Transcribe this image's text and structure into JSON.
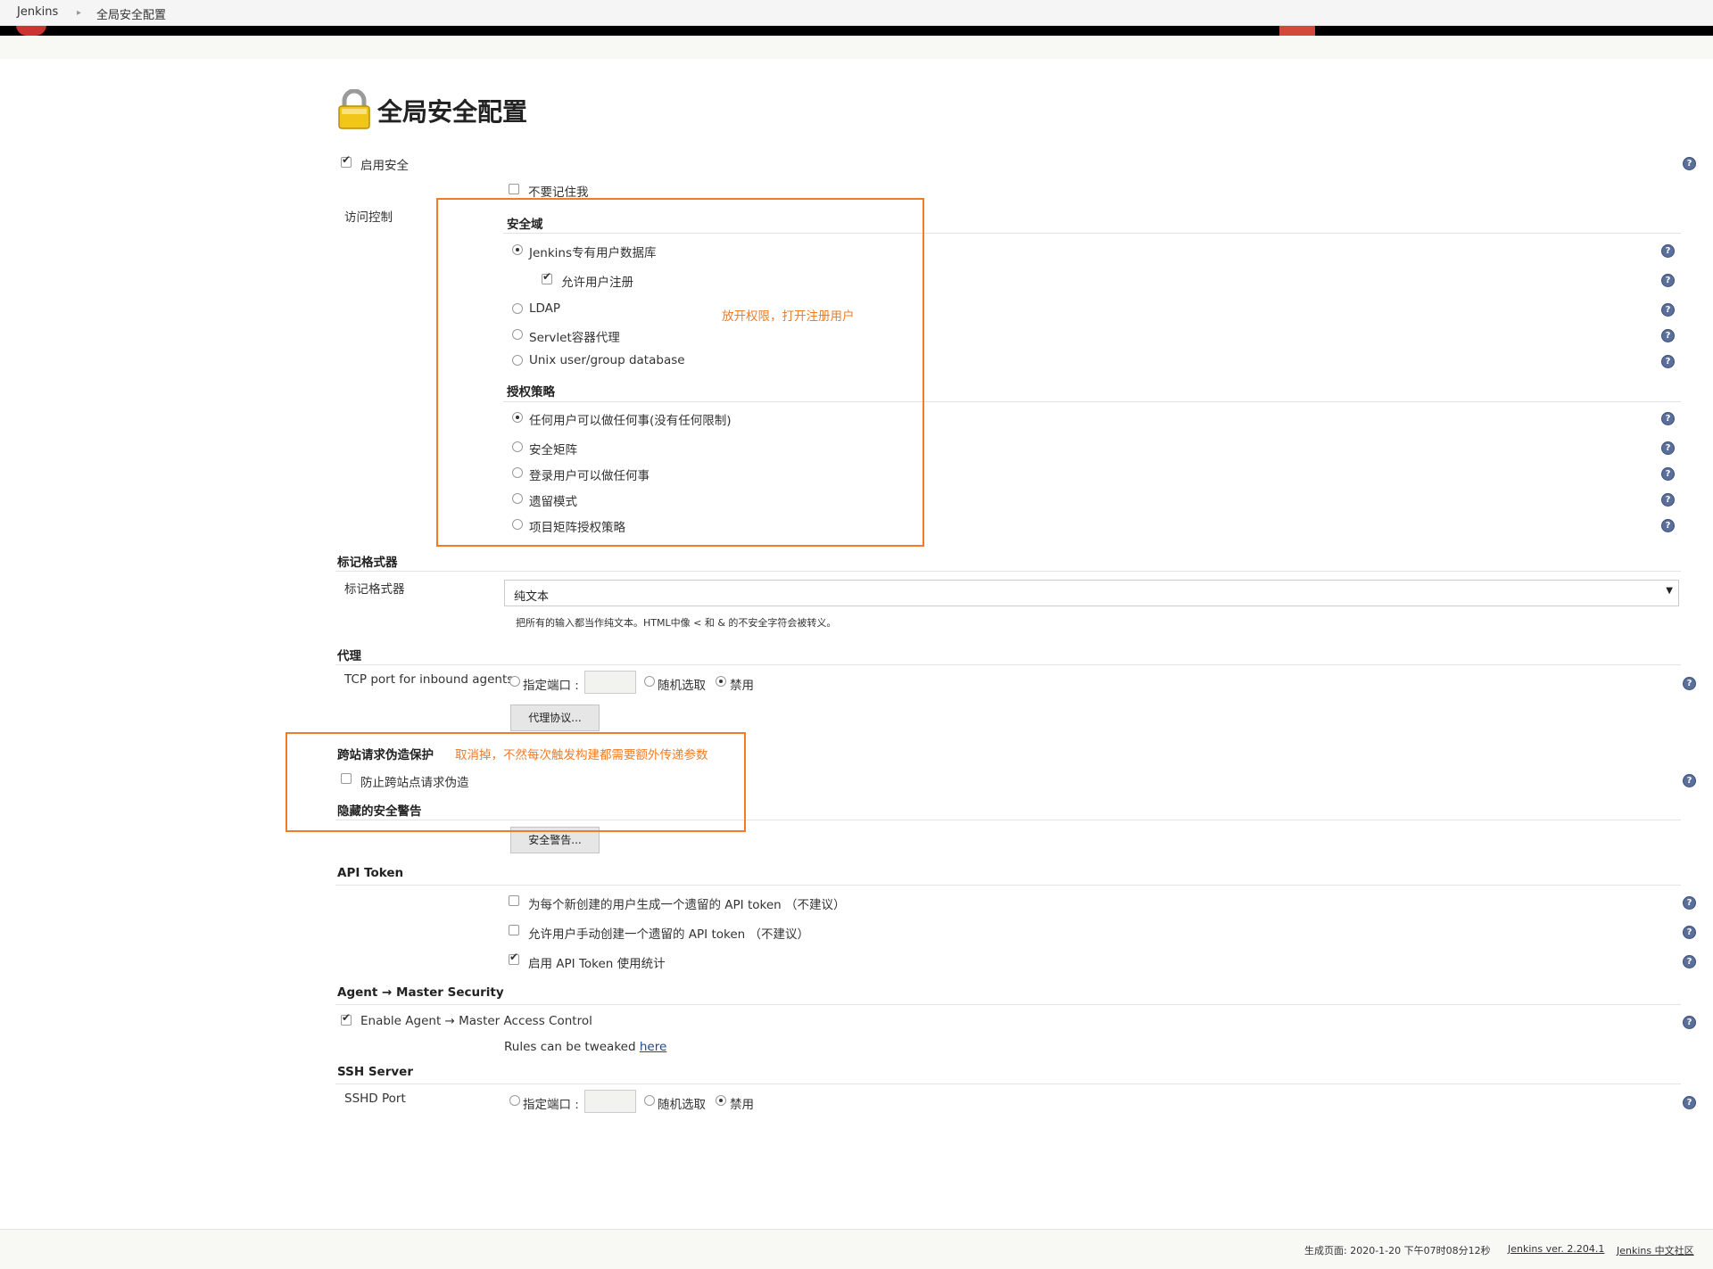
{
  "breadcrumb": {
    "root": "Jenkins",
    "current": "全局安全配置"
  },
  "page_title": "全局安全配置",
  "security": {
    "enable_security": "启用安全",
    "no_remember_me": "不要记住我",
    "access_control_label": "访问控制",
    "realm_heading": "安全域",
    "realm_options": {
      "jenkins_db": "Jenkins专有用户数据库",
      "allow_signup": "允许用户注册",
      "ldap": "LDAP",
      "servlet": "Servlet容器代理",
      "unix": "Unix user/group database"
    },
    "authz_heading": "授权策略",
    "authz_options": {
      "anyone": "任何用户可以做任何事(没有任何限制)",
      "matrix": "安全矩阵",
      "logged_in": "登录用户可以做任何事",
      "legacy": "遗留模式",
      "project_matrix": "项目矩阵授权策略"
    }
  },
  "annotation_1": "放开权限，打开注册用户",
  "markup": {
    "heading": "标记格式器",
    "label": "标记格式器",
    "selected": "纯文本",
    "description": "把所有的输入都当作纯文本。HTML中像 < 和 & 的不安全字符会被转义。"
  },
  "proxy": {
    "heading": "代理",
    "tcp_label": "TCP port for inbound agents",
    "fixed": "指定端口 :",
    "random": "随机选取",
    "disable": "禁用",
    "protocols_button": "代理协议..."
  },
  "csrf": {
    "heading": "跨站请求伪造保护",
    "annotation": "取消掉，不然每次触发构建都需要额外传递参数",
    "prevent": "防止跨站点请求伪造"
  },
  "hidden_warnings": {
    "heading": "隐藏的安全警告",
    "button": "安全警告..."
  },
  "api_token": {
    "heading": "API Token",
    "generate_legacy": "为每个新创建的用户生成一个遗留的 API token （不建议）",
    "allow_manual": "允许用户手动创建一个遗留的 API token （不建议）",
    "usage_stats": "启用 API Token 使用统计"
  },
  "agent_master": {
    "heading": "Agent → Master Security",
    "enable": "Enable Agent → Master Access Control",
    "rules_text": "Rules can be tweaked",
    "rules_link": "here"
  },
  "ssh": {
    "heading": "SSH Server",
    "port_label": "SSHD Port",
    "fixed": "指定端口 :",
    "random": "随机选取",
    "disable": "禁用"
  },
  "footer": {
    "generated": "生成页面: 2020-1-20 下午07时08分12秒",
    "version": "Jenkins ver. 2.204.1",
    "community": "Jenkins 中文社区"
  },
  "colors": {
    "annotation": "#f07c28",
    "help_icon": "#5a6f9a"
  }
}
